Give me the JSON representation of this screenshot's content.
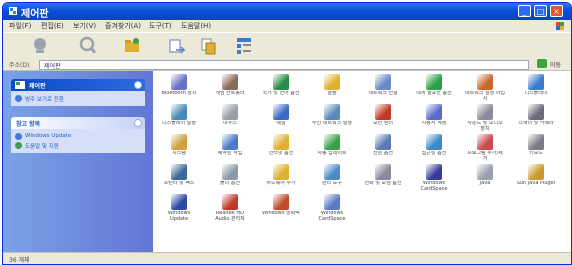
{
  "window": {
    "title": "제어판"
  },
  "menubar": [
    "파일(F)",
    "편집(E)",
    "보기(V)",
    "즐겨찾기(A)",
    "도구(T)",
    "도움말(H)"
  ],
  "toolbar": [
    {
      "icon": "back-icon",
      "color": "#9aa4ad"
    },
    {
      "icon": "search-icon",
      "color": "#9aa4ad"
    },
    {
      "icon": "folders-icon",
      "color": "#d8a83a"
    },
    {
      "icon": "move-icon",
      "color": "#5c83c4"
    },
    {
      "icon": "copy-icon",
      "color": "#d8a83a"
    },
    {
      "icon": "views-icon",
      "color": "#3d7ad6"
    }
  ],
  "address": {
    "label": "주소(D)",
    "value": "제어판",
    "go": "이동"
  },
  "sidepane": {
    "control_panel": {
      "title": "제어판",
      "link": "범주 보기로 전환"
    },
    "see_also": {
      "title": "참고 항목",
      "links": [
        "Windows Update",
        "도움말 및 지원"
      ]
    }
  },
  "items": [
    {
      "label": "Bluetooth 장치",
      "color": "#6a70c8"
    },
    {
      "label": "게임 컨트롤러",
      "color": "#8a6a5a"
    },
    {
      "label": "국가 및 언어 옵션",
      "color": "#2a8a4a"
    },
    {
      "label": "글꼴",
      "color": "#e0b030"
    },
    {
      "label": "네트워크 연결",
      "color": "#6a8ac8"
    },
    {
      "label": "내게 필요한 옵션",
      "color": "#2aa04a"
    },
    {
      "label": "네트워크 설정 마법사",
      "color": "#c86a30"
    },
    {
      "label": "디스플레이",
      "color": "#3a7ac8"
    },
    {
      "label": "디스플레이 설정",
      "color": "#4a8ab8"
    },
    {
      "label": "마우스",
      "color": "#9aa0a8"
    },
    {
      "label": "메일",
      "color": "#3a6ac8"
    },
    {
      "label": "무선 네트워크 설정",
      "color": "#5a8ab8"
    },
    {
      "label": "보안 센터",
      "color": "#c03a2a"
    },
    {
      "label": "사용자 계정",
      "color": "#5a6ac8"
    },
    {
      "label": "사운드 및 오디오 장치",
      "color": "#8a8a9a"
    },
    {
      "label": "스캐너 및 카메라",
      "color": "#6a6a7a"
    },
    {
      "label": "시스템",
      "color": "#d0a040"
    },
    {
      "label": "예약된 작업",
      "color": "#4a7ac8"
    },
    {
      "label": "인터넷 옵션",
      "color": "#e0b030"
    },
    {
      "label": "자동 업데이트",
      "color": "#3aa04a"
    },
    {
      "label": "전원 옵션",
      "color": "#5a7ab8"
    },
    {
      "label": "접근성 옵션",
      "color": "#3a8ac8"
    },
    {
      "label": "프로그램 추가/제거",
      "color": "#c84a4a"
    },
    {
      "label": "키보드",
      "color": "#7a7a8a"
    },
    {
      "label": "프린터 및 팩스",
      "color": "#3a6a9a"
    },
    {
      "label": "폴더 옵션",
      "color": "#8a9aa8"
    },
    {
      "label": "하드웨어 추가",
      "color": "#e0b030"
    },
    {
      "label": "관리 도구",
      "color": "#4a8ac8"
    },
    {
      "label": "전화 및 모뎀 옵션",
      "color": "#8a8a9a"
    },
    {
      "label": "Windows CardSpace",
      "color": "#3a3a9a"
    },
    {
      "label": "Java",
      "color": "#9aa0b0"
    },
    {
      "label": "Sun Java Plugin",
      "color": "#c89a30"
    },
    {
      "label": "Windows Update",
      "color": "#2a4aa8"
    },
    {
      "label": "Realtek HD Audio 관리자",
      "color": "#c03a2a"
    },
    {
      "label": "Windows 방화벽",
      "color": "#c04a2a"
    },
    {
      "label": "Windows CardSpace",
      "color": "#5a7ac8"
    }
  ],
  "status": {
    "text": "36 개체"
  }
}
